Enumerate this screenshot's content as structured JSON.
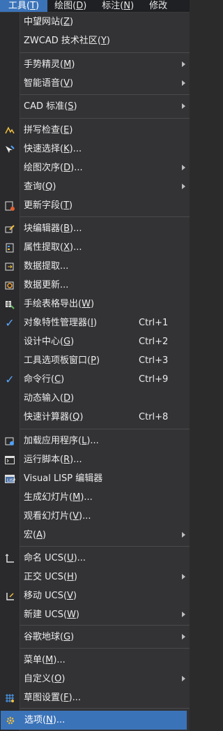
{
  "menubar": {
    "items": [
      {
        "label": "工具",
        "key": "T"
      },
      {
        "label": "绘图",
        "key": "D"
      },
      {
        "label": "标注",
        "key": "N"
      },
      {
        "label": "修改",
        "key": ""
      }
    ]
  },
  "accent": "#3b73b9",
  "check_color": "#5aa6ff",
  "menu": [
    {
      "label": "中望网站",
      "key": "Z"
    },
    {
      "label": "ZWCAD 技术社区",
      "key": "Y"
    },
    {
      "label": "手势精灵",
      "key": "M",
      "submenu": true
    },
    {
      "label": "智能语音",
      "key": "V",
      "submenu": true
    },
    {
      "label": "CAD 标准",
      "key": "S",
      "submenu": true
    },
    {
      "label": "拼写检查",
      "key": "E",
      "icon": "spell-check-icon"
    },
    {
      "label": "快速选择",
      "key": "K",
      "suffix": "...",
      "icon": "quick-select-icon"
    },
    {
      "label": "绘图次序",
      "key": "D",
      "suffix": "...",
      "submenu": true
    },
    {
      "label": "查询",
      "key": "Q",
      "submenu": true
    },
    {
      "label": "更新字段",
      "key": "T",
      "icon": "update-field-icon"
    },
    {
      "label": "块编辑器",
      "key": "B",
      "suffix": "...",
      "icon": "block-editor-icon"
    },
    {
      "label": "属性提取",
      "key": "X",
      "suffix": "...",
      "icon": "attribute-extract-icon"
    },
    {
      "label": "数据提取...",
      "key": "",
      "icon": "data-extract-icon"
    },
    {
      "label": "数据更新...",
      "key": "",
      "icon": "data-update-icon"
    },
    {
      "label": "手绘表格导出",
      "key": "W",
      "icon": "table-export-icon"
    },
    {
      "label": "对象特性管理器",
      "key": "I",
      "shortcut": "Ctrl+1",
      "checked": true
    },
    {
      "label": "设计中心",
      "key": "G",
      "shortcut": "Ctrl+2"
    },
    {
      "label": "工具选项板窗口",
      "key": "P",
      "shortcut": "Ctrl+3"
    },
    {
      "label": "命令行",
      "key": "C",
      "shortcut": "Ctrl+9",
      "checked": true
    },
    {
      "label": "动态输入",
      "key": "D"
    },
    {
      "label": "快速计算器",
      "key": "Q",
      "shortcut": "Ctrl+8"
    },
    {
      "label": "加载应用程序",
      "key": "L",
      "suffix": "...",
      "icon": "load-app-icon"
    },
    {
      "label": "运行脚本",
      "key": "R",
      "suffix": "...",
      "icon": "run-script-icon"
    },
    {
      "label": "Visual LISP 编辑器",
      "key": "",
      "icon": "lisp-editor-icon"
    },
    {
      "label": "生成幻灯片",
      "key": "M",
      "suffix": "..."
    },
    {
      "label": "观看幻灯片",
      "key": "V",
      "suffix": "..."
    },
    {
      "label": "宏",
      "key": "A",
      "submenu": true
    },
    {
      "label": "命名 UCS",
      "key": "U",
      "suffix": "...",
      "icon": "named-ucs-icon"
    },
    {
      "label": "正交 UCS",
      "key": "H",
      "submenu": true
    },
    {
      "label": "移动 UCS",
      "key": "V",
      "icon": "move-ucs-icon"
    },
    {
      "label": "新建 UCS",
      "key": "W",
      "submenu": true
    },
    {
      "label": "谷歌地球",
      "key": "G",
      "submenu": true
    },
    {
      "label": "菜单",
      "key": "M",
      "suffix": "..."
    },
    {
      "label": "自定义",
      "key": "O",
      "submenu": true
    },
    {
      "label": "草图设置",
      "key": "F",
      "suffix": "...",
      "icon": "drafting-settings-icon"
    },
    {
      "label": "选项",
      "key": "N",
      "suffix": "...",
      "icon": "options-gear-icon",
      "selected": true
    }
  ]
}
